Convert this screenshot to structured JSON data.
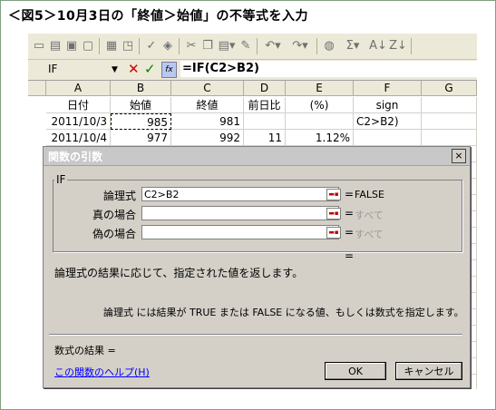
{
  "figure_title": "＜図5＞10月3日の「終値＞始値」の不等式を入力",
  "toolbar": {
    "icons": [
      "new-icon",
      "open-icon",
      "save-icon",
      "permission-icon",
      "print-icon",
      "print-preview-icon",
      "spelling-icon",
      "research-icon",
      "cut-icon",
      "copy-icon",
      "paste-icon",
      "format-painter-icon",
      "undo-icon",
      "redo-icon",
      "hyperlink-icon",
      "autosum-icon",
      "sort-ascending-icon",
      "sort-descending-icon"
    ],
    "glyphs": {
      "autosum": "Σ",
      "sort_asc": "A↓",
      "sort_desc": "Z↓"
    }
  },
  "formula_bar": {
    "name_box": "IF",
    "cancel": "✕",
    "enter": "✓",
    "fx": "fx",
    "formula": "=IF(C2>B2)"
  },
  "columns": [
    "A",
    "B",
    "C",
    "D",
    "E",
    "F",
    "G"
  ],
  "rows": [
    {
      "a": "日付",
      "b": "始値",
      "c": "終値",
      "d": "前日比",
      "e": "(%)",
      "f": "sign"
    },
    {
      "a": "2011/10/3",
      "b": "985",
      "c": "981",
      "d": "",
      "e": "",
      "f": "C2>B2)"
    },
    {
      "a": "2011/10/4",
      "b": "977",
      "c": "992",
      "d": "11",
      "e": "1.12%",
      "f": ""
    }
  ],
  "dialog": {
    "title": "関数の引数",
    "close": "×",
    "function_name": "IF",
    "args": [
      {
        "label": "論理式",
        "value": "C2>B2",
        "result": "FALSE"
      },
      {
        "label": "真の場合",
        "value": "",
        "result": "すべて"
      },
      {
        "label": "偽の場合",
        "value": "",
        "result": "すべて"
      }
    ],
    "equals": "=",
    "description": "論理式の結果に応じて、指定された値を返します。",
    "arg_description": "論理式 には結果が TRUE または FALSE になる値、もしくは数式を指定します。",
    "formula_result": "数式の結果 =",
    "help_link": "この関数のヘルプ(H)",
    "ok": "OK",
    "cancel": "キャンセル"
  }
}
